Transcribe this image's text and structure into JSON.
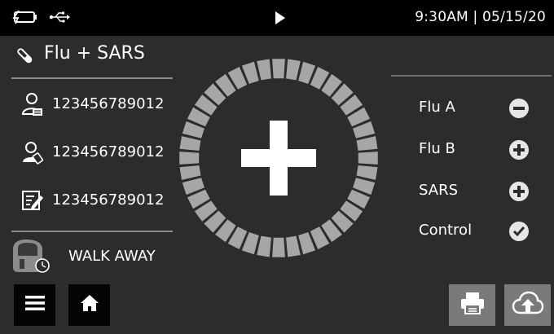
{
  "status_bar": {
    "icons": [
      "battery-charging-icon",
      "usb-icon",
      "play-icon"
    ],
    "datetime": "9:30AM  |  05/15/20"
  },
  "test": {
    "name": "Flu + SARS",
    "icon": "test-tube-icon"
  },
  "info_rows": [
    {
      "icon": "patient-id-icon",
      "value": "123456789012"
    },
    {
      "icon": "operator-id-icon",
      "value": "123456789012"
    },
    {
      "icon": "sample-id-icon",
      "value": "123456789012"
    }
  ],
  "mode": {
    "label": "WALK AWAY",
    "icon": "walk-away-icon"
  },
  "overall_result": {
    "symbol": "+",
    "meaning": "positive",
    "ring_segments": 40
  },
  "analytes": [
    {
      "name": "Flu A",
      "result": "negative",
      "icon": "minus-circle-icon"
    },
    {
      "name": "Flu B",
      "result": "positive",
      "icon": "plus-circle-icon"
    },
    {
      "name": "SARS",
      "result": "positive",
      "icon": "plus-circle-icon"
    },
    {
      "name": "Control",
      "result": "valid",
      "icon": "check-circle-icon"
    }
  ],
  "buttons": {
    "menu": "menu-icon",
    "home": "home-icon",
    "print": "printer-icon",
    "upload": "cloud-upload-icon"
  },
  "colors": {
    "background": "#2c2c2c",
    "status_bar": "#000000",
    "ring_segment": "#a6a6a6",
    "action_button": "#7a7a7a",
    "indicator": "#e6e6e6"
  }
}
